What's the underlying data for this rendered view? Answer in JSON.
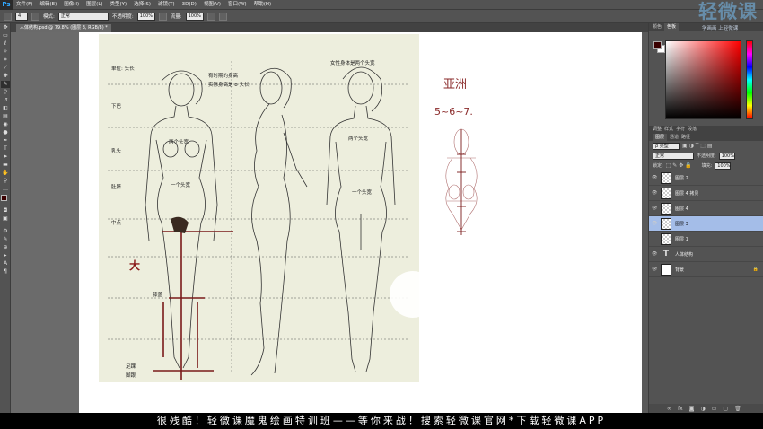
{
  "app": {
    "logo": "Ps"
  },
  "menubar": {
    "items": [
      "文件(F)",
      "编辑(E)",
      "图像(I)",
      "图层(L)",
      "类型(Y)",
      "选择(S)",
      "滤镜(T)",
      "3D(D)",
      "视图(V)",
      "窗口(W)",
      "帮助(H)"
    ]
  },
  "options": {
    "mode_label": "模式:",
    "mode_value": "正常",
    "opacity_label": "不透明度:",
    "opacity_value": "100%",
    "flow_label": "流量:",
    "flow_value": "100%"
  },
  "document": {
    "tab_title": "人体结构.psd @ 79.8% (图层 3, RGB/8) *"
  },
  "scan_text": {
    "unit": "单位: 头长",
    "female_title": "女性身体是两个头宽",
    "real_height": "有时期的身高",
    "actual_height": "实际身高是 8 头长",
    "head_width": "两个头宽",
    "one_head": "一个头宽",
    "midpoint": "中点",
    "knee": "膝盖",
    "foot": "足踝",
    "heel": "脚跟",
    "chin": "下巴",
    "nipple": "乳头",
    "navel": "肚脐",
    "big": "大"
  },
  "annotations": {
    "asia": "亚洲",
    "ratio": "5~6~7."
  },
  "color_panel": {
    "tabs": [
      "颜色",
      "色板"
    ],
    "fg_color": "#3a0000",
    "bg_color": "#ffffff"
  },
  "sub_tabs": [
    "调整",
    "样式",
    "字符",
    "段落"
  ],
  "layers_panel": {
    "tabs": [
      "图层",
      "通道",
      "路径"
    ],
    "kind_label": "ρ 类型",
    "blend_mode": "正常",
    "opacity_label": "不透明度:",
    "opacity_value": "100%",
    "lock_label": "锁定:",
    "fill_label": "填充:",
    "fill_value": "100%",
    "layers": [
      {
        "name": "图层 2",
        "visible": true,
        "selected": false,
        "type": "pixel"
      },
      {
        "name": "图层 4 拷贝",
        "visible": true,
        "selected": false,
        "type": "pixel"
      },
      {
        "name": "图层 4",
        "visible": true,
        "selected": false,
        "type": "pixel"
      },
      {
        "name": "图层 3",
        "visible": true,
        "selected": true,
        "type": "pixel"
      },
      {
        "name": "图层 1",
        "visible": false,
        "selected": false,
        "type": "pixel"
      },
      {
        "name": "人体结构",
        "visible": true,
        "selected": false,
        "type": "text"
      },
      {
        "name": "背景",
        "visible": true,
        "selected": false,
        "type": "bg"
      }
    ]
  },
  "watermark": {
    "big": "轻微课",
    "small": "学画画 上轻微课"
  },
  "banner": {
    "text": "很残酷！轻微课魔鬼绘画特训班——等你来战！搜索轻微课官网*下载轻微课APP"
  }
}
